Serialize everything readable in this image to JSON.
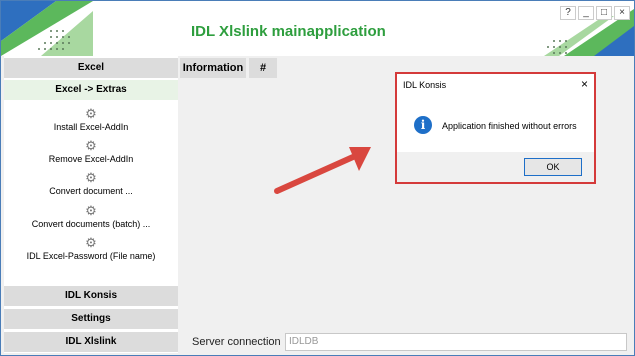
{
  "window": {
    "title": "IDL Xlslink mainapplication",
    "controls": [
      "?",
      "_",
      "□",
      "×"
    ]
  },
  "sidebar": {
    "sections": {
      "excel": "Excel",
      "excel_extras": "Excel -> Extras",
      "idl_konsis": "IDL Konsis",
      "settings": "Settings",
      "idl_xlslink": "IDL Xlslink"
    },
    "tools": [
      {
        "label": "Install Excel-AddIn",
        "icon": "gear-icon"
      },
      {
        "label": "Remove Excel-AddIn",
        "icon": "gear-icon"
      },
      {
        "label": "Convert document ...",
        "icon": "gear-icon"
      },
      {
        "label": "Convert documents (batch) ...",
        "icon": "gear-icon"
      },
      {
        "label": "IDL Excel-Password (File name)",
        "icon": "gear-icon"
      }
    ]
  },
  "main": {
    "tabs": [
      "Information",
      "#"
    ]
  },
  "status": {
    "label": "Server connection",
    "value": "IDLDB"
  },
  "dialog": {
    "title": "IDL Konsis",
    "close": "×",
    "icon": "info-icon",
    "message": "Application finished without errors",
    "ok_label": "OK"
  },
  "colors": {
    "title_green": "#2e9e3e",
    "dialog_border": "#d43a3a",
    "info_blue": "#1e6fc8",
    "arrow_red": "#d9473f"
  }
}
